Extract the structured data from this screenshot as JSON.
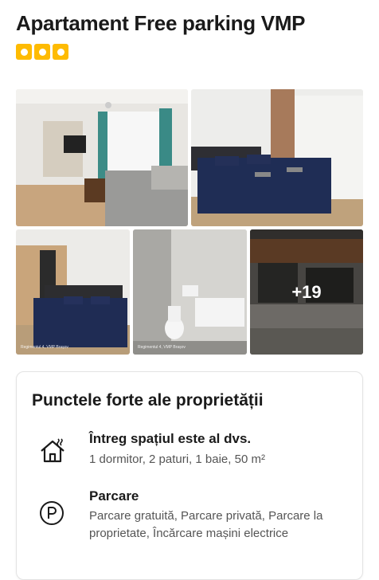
{
  "property": {
    "title": "Apartament Free parking VMP",
    "rating_squares": 3,
    "accent_color": "#febb02"
  },
  "gallery": {
    "more_photos_label": "+19",
    "watermark": "Regimentul 4, VMP Brașov"
  },
  "highlights": {
    "title": "Punctele forte ale proprietății",
    "items": [
      {
        "icon": "house-icon",
        "name": "Întreg spațiul este al dvs.",
        "description": "1 dormitor, 2 paturi, 1 baie, 50 m²"
      },
      {
        "icon": "parking-icon",
        "name": "Parcare",
        "description": "Parcare gratuită, Parcare privată, Parcare la proprietate, Încărcare mașini electrice"
      }
    ]
  }
}
